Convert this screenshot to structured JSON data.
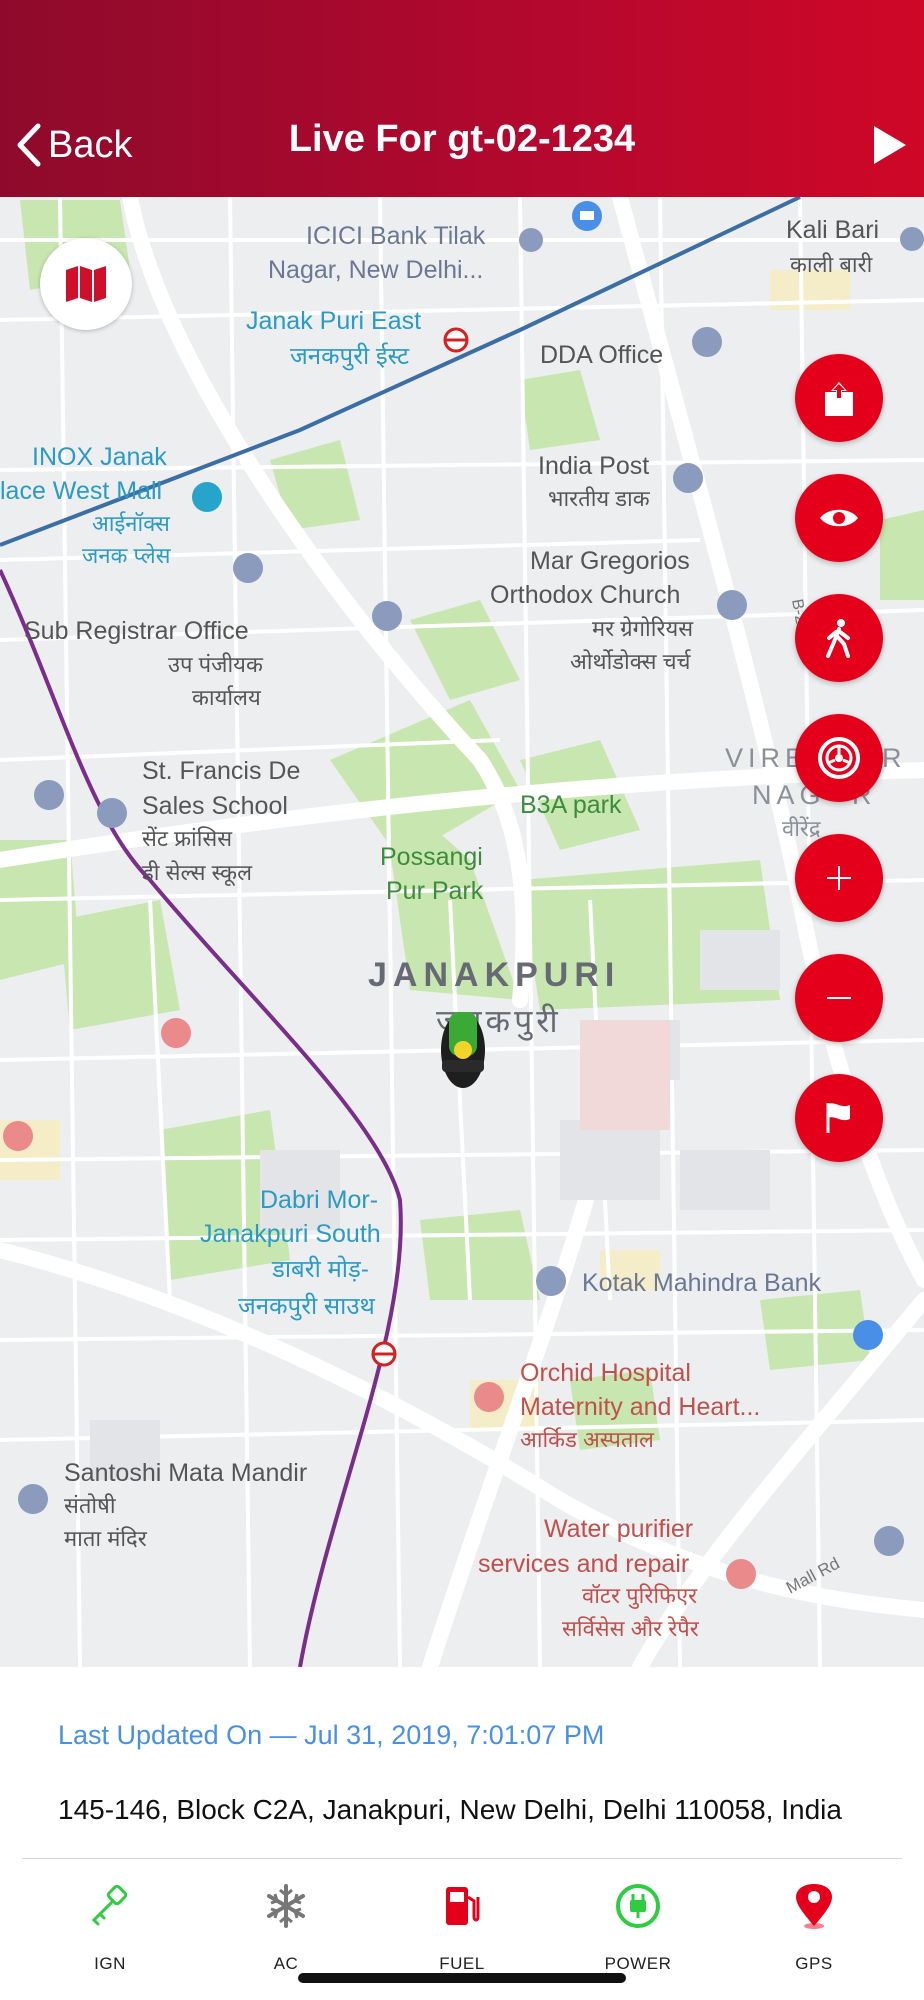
{
  "header": {
    "back_label": "Back",
    "title": "Live For gt-02-1234"
  },
  "map": {
    "labels": {
      "icici": "ICICI Bank Tilak",
      "icici2": "Nagar, New Delhi...",
      "kali": "Kali Bari",
      "kali_hi": "काली बारी",
      "janak_east": "Janak Puri East",
      "janak_east_hi": "जनकपुरी ईस्ट",
      "dda": "DDA Office",
      "inox1": "INOX Janak",
      "inox2": "lace West Mall",
      "inox_hi1": "आईनॉक्स",
      "inox_hi2": "जनक प्लेस",
      "indiapost": "India Post",
      "indiapost_hi": "भारतीय डाक",
      "mar1": "Mar Gregorios",
      "mar2": "Orthodox Church",
      "mar_hi1": "मर ग्रेगोरियस",
      "mar_hi2": "ओर्थोडोक्स चर्च",
      "subreg": "Sub Registrar Office",
      "subreg_hi1": "उप पंजीयक",
      "subreg_hi2": "कार्यालय",
      "stfrancis1": "St. Francis De",
      "stfrancis2": "Sales School",
      "stfrancis_hi1": "सेंट फ्रांसिस",
      "stfrancis_hi2": "डी सेल्स स्कूल",
      "b3a": "B3A park",
      "vire1": "VIRE",
      "vire2": "NAG",
      "vire_hi": "वीरेंद्र",
      "r1": "R",
      "r2": "R",
      "possangi1": "Possangi",
      "possangi2": "Pur Park",
      "janakpuri": "JANAKPURI",
      "janakpuri_hi": "जनकपुरी",
      "dabri1": "Dabri Mor-",
      "dabri2": "Janakpuri South",
      "dabri_hi1": "डाबरी मोड़-",
      "dabri_hi2": "जनकपुरी साउथ",
      "kotak": "Kotak Mahindra Bank",
      "orchid1": "Orchid Hospital",
      "orchid2": "Maternity and Heart...",
      "orchid_hi": "आर्किड अस्पताल",
      "santoshi": "Santoshi Mata Mandir",
      "santoshi_hi1": "संतोषी",
      "santoshi_hi2": "माता मंदिर",
      "water1": "Water purifier",
      "water2": "services and repair",
      "water_hi1": "वॉटर पुरिफिएर",
      "water_hi2": "सर्विसेस और रेपैर",
      "b2": "B-2",
      "mallrd": "Mall Rd"
    }
  },
  "controls": {
    "icons": [
      "map-type-icon",
      "share-icon",
      "eye-icon",
      "walk-icon",
      "steering-wheel-icon",
      "zoom-in-icon",
      "zoom-out-icon",
      "flag-icon"
    ]
  },
  "info": {
    "last_updated": "Last Updated On — Jul 31, 2019, 7:01:07 PM",
    "address": "145-146, Block C2A, Janakpuri, New Delhi, Delhi 110058, India"
  },
  "status_bar": {
    "ign": "IGN",
    "ac": "AC",
    "fuel": "FUEL",
    "power": "POWER",
    "gps": "GPS"
  },
  "colors": {
    "accent": "#e4001b",
    "link": "#4a90e2",
    "ign": "#2ecc40",
    "ac": "#777777",
    "fuel": "#e4001b",
    "power": "#2ecc40",
    "gps": "#e4001b"
  }
}
